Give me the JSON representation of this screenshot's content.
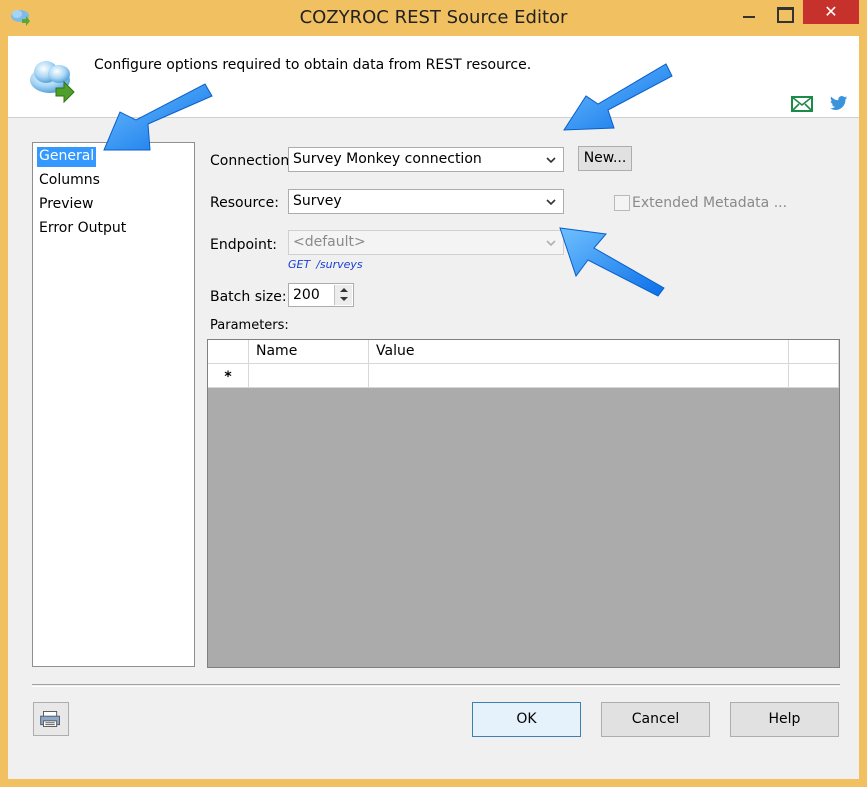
{
  "window": {
    "title": "COZYROC REST Source Editor",
    "close_glyph": "✕"
  },
  "header": {
    "description": "Configure options required to obtain data from REST resource."
  },
  "nav": {
    "items": [
      "General",
      "Columns",
      "Preview",
      "Error Output"
    ],
    "selected": "General"
  },
  "form": {
    "connection_label": "Connection:",
    "connection_value": "Survey Monkey connection",
    "new_button": "New...",
    "resource_label": "Resource:",
    "resource_value": "Survey",
    "extended_metadata_label": "Extended Metadata ...",
    "extended_metadata_checked": false,
    "endpoint_label": "Endpoint:",
    "endpoint_value": "<default>",
    "endpoint_method": "GET",
    "endpoint_path": "/surveys",
    "batch_label": "Batch size:",
    "batch_value": "200",
    "parameters_label": "Parameters:"
  },
  "grid": {
    "columns": [
      "Name",
      "Value"
    ],
    "new_row_marker": "*"
  },
  "footer": {
    "ok": "OK",
    "cancel": "Cancel",
    "help": "Help"
  },
  "colors": {
    "title_bar": "#f0c061",
    "close_button": "#c7312b",
    "selection": "#3399ff",
    "arrow": "#1e7ff0"
  }
}
